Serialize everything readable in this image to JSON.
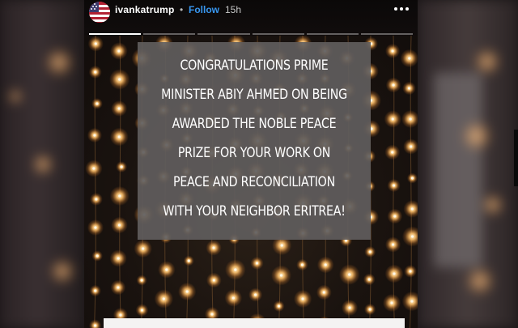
{
  "story": {
    "username": "ivankatrump",
    "separator": "•",
    "follow_label": "Follow",
    "timestamp": "15h",
    "more_icon": "more-horizontal-icon",
    "avatar_icon": "flag-avatar-icon",
    "progress": {
      "segments": 6,
      "active_index": 0
    }
  },
  "card": {
    "lines": [
      "CONGRATULATIONS PRIME",
      "MINISTER ABIY AHMED ON BEING",
      "AWARDED THE NOBLE PEACE",
      "PRIZE FOR YOUR WORK ON",
      "PEACE AND RECONCILIATION",
      "WITH YOUR NEIGHBOR ERITREA!"
    ]
  },
  "colors": {
    "follow": "#3897f0",
    "card_background": "#605c5c",
    "light_glow": "#ffb35a"
  }
}
